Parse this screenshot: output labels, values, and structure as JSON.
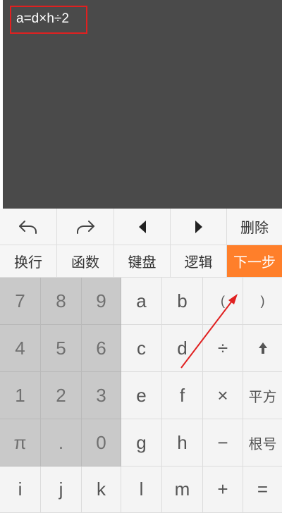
{
  "editor": {
    "formula": "a=d×h÷2"
  },
  "toolbar": {
    "undo_icon": "undo-icon",
    "redo_icon": "redo-icon",
    "left_icon": "caret-left-icon",
    "right_icon": "caret-right-icon",
    "delete_label": "删除"
  },
  "tabs": {
    "newline": "换行",
    "functions": "函数",
    "keyboard": "键盘",
    "logic": "逻辑",
    "next": "下一步"
  },
  "keys": {
    "r1": [
      "7",
      "8",
      "9",
      "a",
      "b",
      "(",
      ")"
    ],
    "r2": [
      "4",
      "5",
      "6",
      "c",
      "d",
      "÷",
      "up-arrow-icon"
    ],
    "r3": [
      "1",
      "2",
      "3",
      "e",
      "f",
      "×",
      "平方"
    ],
    "r4": [
      "π",
      ".",
      "0",
      "g",
      "h",
      "−",
      "根号"
    ],
    "r5": [
      "i",
      "j",
      "k",
      "l",
      "m",
      "+",
      "="
    ]
  },
  "colors": {
    "accent": "#ff7f2a",
    "editor_bg": "#4a4a4a",
    "highlight_box": "#e02020",
    "annotation_arrow": "#e02020"
  }
}
